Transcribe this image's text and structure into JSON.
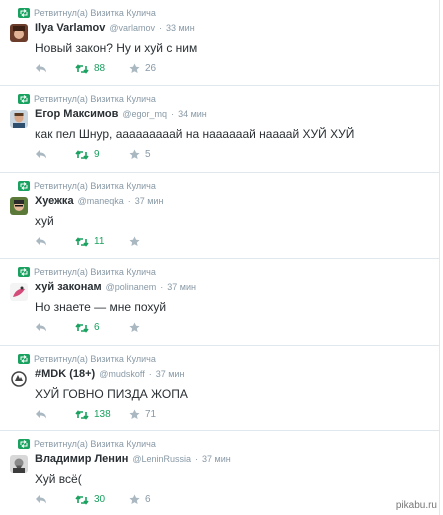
{
  "retweet_label": "Ретвитнул(а) Визитка Кулича",
  "tweets": [
    {
      "name": "Ilya Varlamov",
      "handle": "@varlamov",
      "time": "33 мин",
      "text": "Новый закон? Ну и хуй с ним",
      "retweets": "88",
      "favorites": "26"
    },
    {
      "name": "Егор Максимов",
      "handle": "@egor_mq",
      "time": "34 мин",
      "text": "как пел Шнур, ааааааааай на наааааай наааай ХУЙ ХУЙ",
      "retweets": "9",
      "favorites": "5"
    },
    {
      "name": "Хуежка",
      "handle": "@maneqka",
      "time": "37 мин",
      "text": "хуй",
      "retweets": "11",
      "favorites": ""
    },
    {
      "name": "хуй законам",
      "handle": "@polinanem",
      "time": "37 мин",
      "text": "Но знаете — мне похуй",
      "retweets": "6",
      "favorites": ""
    },
    {
      "name": "#MDK (18+)",
      "handle": "@mudskoff",
      "time": "37 мин",
      "text": "ХУЙ ГОВНО ПИЗДА ЖОПА",
      "retweets": "138",
      "favorites": "71"
    },
    {
      "name": "Владимир Ленин",
      "handle": "@LeninRussia",
      "time": "37 мин",
      "text": "Хуй всё(",
      "retweets": "30",
      "favorites": "6"
    }
  ],
  "watermark": "pikabu.ru",
  "colors": {
    "retweet_green": "#19a15f",
    "meta_gray": "#8899a6",
    "divider": "#e1e8ed"
  }
}
